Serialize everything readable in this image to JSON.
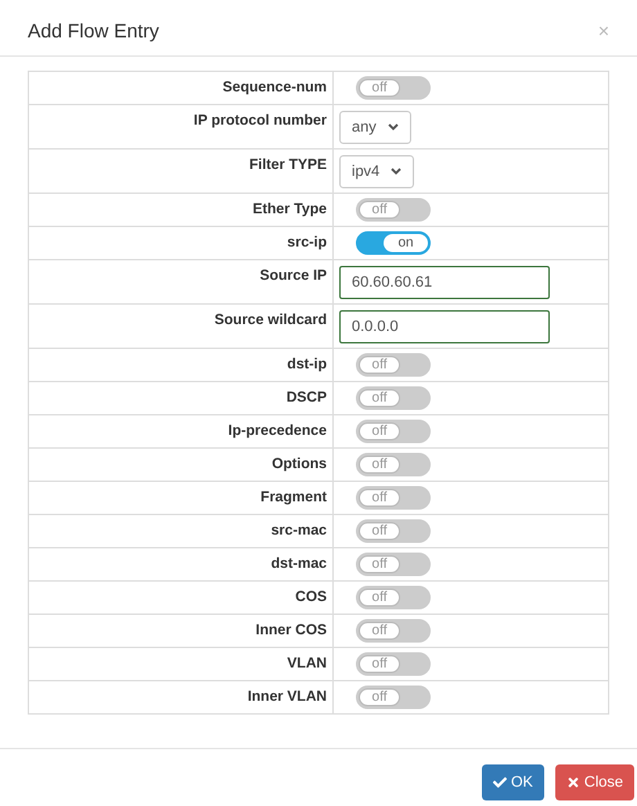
{
  "dialog": {
    "title": "Add Flow Entry",
    "close_icon": "×"
  },
  "rows": [
    {
      "label": "Sequence-num",
      "kind": "toggle",
      "on": false,
      "text": "off"
    },
    {
      "label": "IP protocol number",
      "kind": "select",
      "value": "any"
    },
    {
      "label": "Filter TYPE",
      "kind": "select",
      "value": "ipv4"
    },
    {
      "label": "Ether Type",
      "kind": "toggle",
      "on": false,
      "text": "off"
    },
    {
      "label": "src-ip",
      "kind": "toggle",
      "on": true,
      "text": "on"
    },
    {
      "label": "Source IP",
      "kind": "input",
      "value": "60.60.60.61"
    },
    {
      "label": "Source wildcard",
      "kind": "input",
      "value": "0.0.0.0"
    },
    {
      "label": "dst-ip",
      "kind": "toggle",
      "on": false,
      "text": "off"
    },
    {
      "label": "DSCP",
      "kind": "toggle",
      "on": false,
      "text": "off"
    },
    {
      "label": "Ip-precedence",
      "kind": "toggle",
      "on": false,
      "text": "off"
    },
    {
      "label": "Options",
      "kind": "toggle",
      "on": false,
      "text": "off"
    },
    {
      "label": "Fragment",
      "kind": "toggle",
      "on": false,
      "text": "off"
    },
    {
      "label": "src-mac",
      "kind": "toggle",
      "on": false,
      "text": "off"
    },
    {
      "label": "dst-mac",
      "kind": "toggle",
      "on": false,
      "text": "off"
    },
    {
      "label": "COS",
      "kind": "toggle",
      "on": false,
      "text": "off"
    },
    {
      "label": "Inner COS",
      "kind": "toggle",
      "on": false,
      "text": "off"
    },
    {
      "label": "VLAN",
      "kind": "toggle",
      "on": false,
      "text": "off"
    },
    {
      "label": "Inner VLAN",
      "kind": "toggle",
      "on": false,
      "text": "off"
    }
  ],
  "buttons": [
    {
      "label": "OK",
      "kind": "primary"
    },
    {
      "label": "Close",
      "kind": "danger"
    }
  ]
}
